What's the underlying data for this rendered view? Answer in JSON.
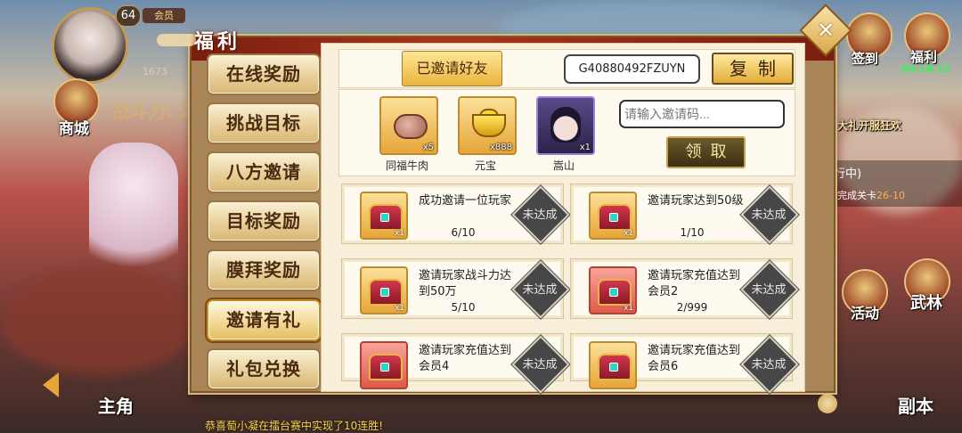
{
  "hud": {
    "level": "64",
    "vip": "会员",
    "small_number": "1673",
    "power_label": "战斗力: 2",
    "shop_label": "商城",
    "signin_label": "签到",
    "welfare_label": "福利",
    "timer": "00:18:15",
    "bigprize_label": "大礼开服狂欢",
    "activity_label": "活动",
    "wulin_label": "武林",
    "main_char_label": "主角",
    "dungeon_label": "副本",
    "stage_line1": "行中)",
    "stage_line2_prefix": "完成关卡",
    "stage_line2_value": "26-10",
    "ticker": "恭喜萄小凝在擂台赛中实现了10连胜!"
  },
  "panel": {
    "title": "福利",
    "close_symbol": "✕",
    "tabs": [
      {
        "label": "在线奖励",
        "active": false
      },
      {
        "label": "挑战目标",
        "active": false
      },
      {
        "label": "八方邀请",
        "active": false
      },
      {
        "label": "目标奖励",
        "active": false
      },
      {
        "label": "膜拜奖励",
        "active": false
      },
      {
        "label": "邀请有礼",
        "active": true
      },
      {
        "label": "礼包兑换",
        "active": false
      }
    ],
    "invited_friends_btn": "已邀请好友",
    "invite_code": "G40880492FZUYN",
    "copy_btn": "复制",
    "rewards": [
      {
        "name": "同福牛肉",
        "count": "x5",
        "icon": "beef-icon"
      },
      {
        "name": "元宝",
        "count": "x888",
        "icon": "gold-ingot-icon"
      },
      {
        "name": "嵩山",
        "count": "x1",
        "icon": "hero-portrait-icon"
      }
    ],
    "invite_input_placeholder": "请输入邀请码...",
    "claim_btn": "领取",
    "tasks": [
      {
        "desc": "成功邀请一位玩家",
        "progress": "6/10",
        "status": "未达成",
        "chest": "gold"
      },
      {
        "desc": "邀请玩家达到50级",
        "progress": "1/10",
        "status": "未达成",
        "chest": "gold"
      },
      {
        "desc": "邀请玩家战斗力达到50万",
        "progress": "5/10",
        "status": "未达成",
        "chest": "gold"
      },
      {
        "desc": "邀请玩家充值达到会员2",
        "progress": "2/999",
        "status": "未达成",
        "chest": "red"
      },
      {
        "desc": "邀请玩家充值达到会员4",
        "progress": "",
        "status": "未达成",
        "chest": "red"
      },
      {
        "desc": "邀请玩家充值达到会员6",
        "progress": "",
        "status": "未达成",
        "chest": "gold"
      }
    ],
    "chest_count": "x1"
  }
}
